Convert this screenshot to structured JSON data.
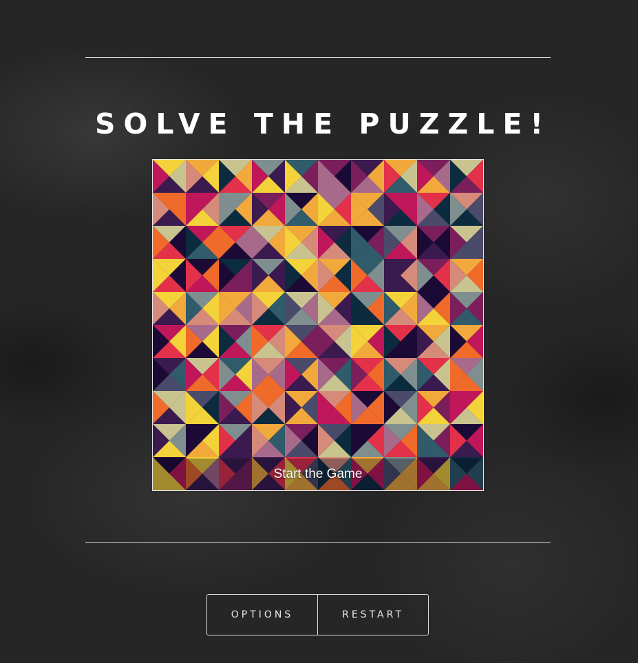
{
  "page": {
    "title": "SOLVE THE PUZZLE!",
    "start_label": "Start the Game"
  },
  "controls": {
    "options_label": "OPTIONS",
    "restart_label": "RESTART"
  },
  "puzzle": {
    "grid_size": 10,
    "palette": [
      "#1c0a36",
      "#3a1a4f",
      "#7a1f5c",
      "#c0165a",
      "#e3314a",
      "#f06a2a",
      "#f2a93b",
      "#f3d23a",
      "#c8c38f",
      "#7f8f8f",
      "#2f5b6b",
      "#0d2b3f",
      "#4a4a6a",
      "#d58a7a",
      "#a86a8a"
    ]
  },
  "colors": {
    "background": "#262626",
    "rule": "#d9d9d9",
    "text": "#ffffff"
  }
}
